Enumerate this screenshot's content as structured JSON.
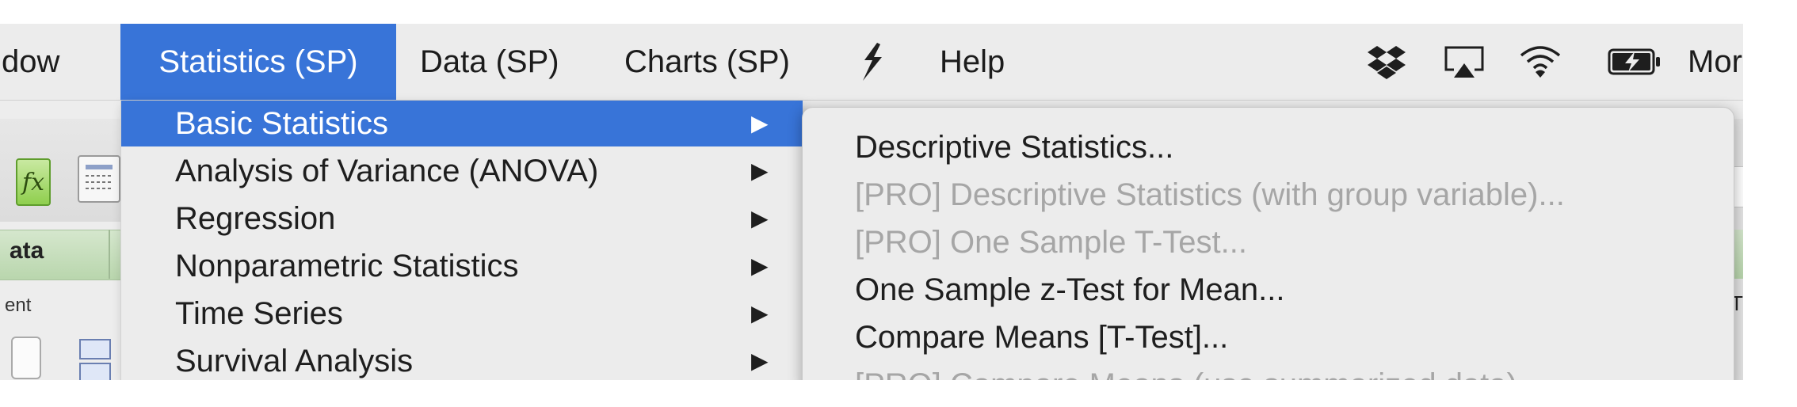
{
  "menubar": {
    "items": [
      {
        "label": "dow",
        "active": false
      },
      {
        "label": "Statistics (SP)",
        "active": true
      },
      {
        "label": "Data (SP)",
        "active": false
      },
      {
        "label": "Charts (SP)",
        "active": false
      },
      {
        "label": "Help",
        "active": false
      }
    ],
    "truncated_right_label": "Mor",
    "status_icons": [
      "dropbox-icon",
      "airplay-icon",
      "wifi-icon",
      "battery-charging-icon"
    ],
    "app_icon": "sp-logo-icon"
  },
  "statistics_menu": {
    "items": [
      {
        "label": "Basic Statistics",
        "has_submenu": true,
        "highlighted": true
      },
      {
        "label": "Analysis of Variance (ANOVA)",
        "has_submenu": true,
        "highlighted": false
      },
      {
        "label": "Regression",
        "has_submenu": true,
        "highlighted": false
      },
      {
        "label": "Nonparametric Statistics",
        "has_submenu": true,
        "highlighted": false
      },
      {
        "label": "Time Series",
        "has_submenu": true,
        "highlighted": false
      },
      {
        "label": "Survival Analysis",
        "has_submenu": true,
        "highlighted": false
      }
    ],
    "submenu_arrow": "▶"
  },
  "basic_statistics_submenu": {
    "items": [
      {
        "label": "Descriptive Statistics...",
        "enabled": true
      },
      {
        "label": "[PRO] Descriptive Statistics (with group variable)...",
        "enabled": false
      },
      {
        "label": "[PRO] One Sample T-Test...",
        "enabled": false
      },
      {
        "label": "One Sample z-Test for Mean...",
        "enabled": true
      },
      {
        "label": "Compare Means [T-Test]...",
        "enabled": true
      },
      {
        "label": "[PRO] Compare Means (use summarized data)...",
        "enabled": false
      }
    ]
  },
  "background_app": {
    "fx_label": "fx",
    "tab_label": "ata",
    "ribbon_label": "ent",
    "right_edge_label": "T"
  },
  "colors": {
    "menubar_bg": "#ececec",
    "highlight": "#3874d8",
    "disabled_text": "#a6a6a6",
    "text": "#1e1e1e"
  }
}
